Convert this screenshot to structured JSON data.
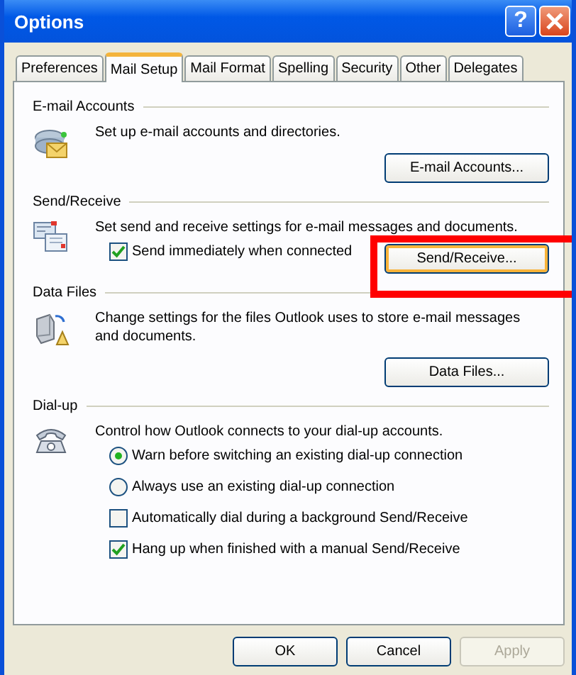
{
  "window": {
    "title": "Options",
    "help_glyph": "?"
  },
  "tabs": [
    {
      "label": "Preferences",
      "selected": false
    },
    {
      "label": "Mail Setup",
      "selected": true
    },
    {
      "label": "Mail Format",
      "selected": false
    },
    {
      "label": "Spelling",
      "selected": false
    },
    {
      "label": "Security",
      "selected": false
    },
    {
      "label": "Other",
      "selected": false
    },
    {
      "label": "Delegates",
      "selected": false
    }
  ],
  "sections": [
    {
      "heading": "E-mail Accounts",
      "description": "Set up e-mail accounts and directories.",
      "button": {
        "label": "E-mail Accounts...",
        "focused": false
      }
    },
    {
      "heading": "Send/Receive",
      "description": "Set send and receive settings for e-mail messages and documents.",
      "options": [
        {
          "kind": "checkbox",
          "label": "Send immediately when connected",
          "checked": true
        }
      ],
      "button": {
        "label": "Send/Receive...",
        "focused": true
      }
    },
    {
      "heading": "Data Files",
      "description": "Change settings for the files Outlook uses to store e-mail messages and documents.",
      "button": {
        "label": "Data Files...",
        "focused": false
      }
    },
    {
      "heading": "Dial-up",
      "description": "Control how Outlook connects to your dial-up accounts.",
      "options": [
        {
          "kind": "radio",
          "label": "Warn before switching an existing dial-up connection",
          "selected": true
        },
        {
          "kind": "radio",
          "label": "Always use an existing dial-up connection",
          "selected": false
        },
        {
          "kind": "checkbox",
          "label": "Automatically dial during a background Send/Receive",
          "checked": false
        },
        {
          "kind": "checkbox",
          "label": "Hang up when finished with a manual Send/Receive",
          "checked": true
        }
      ]
    }
  ],
  "footer_buttons": [
    {
      "label": "OK",
      "disabled": false
    },
    {
      "label": "Cancel",
      "disabled": false
    },
    {
      "label": "Apply",
      "disabled": true
    }
  ]
}
